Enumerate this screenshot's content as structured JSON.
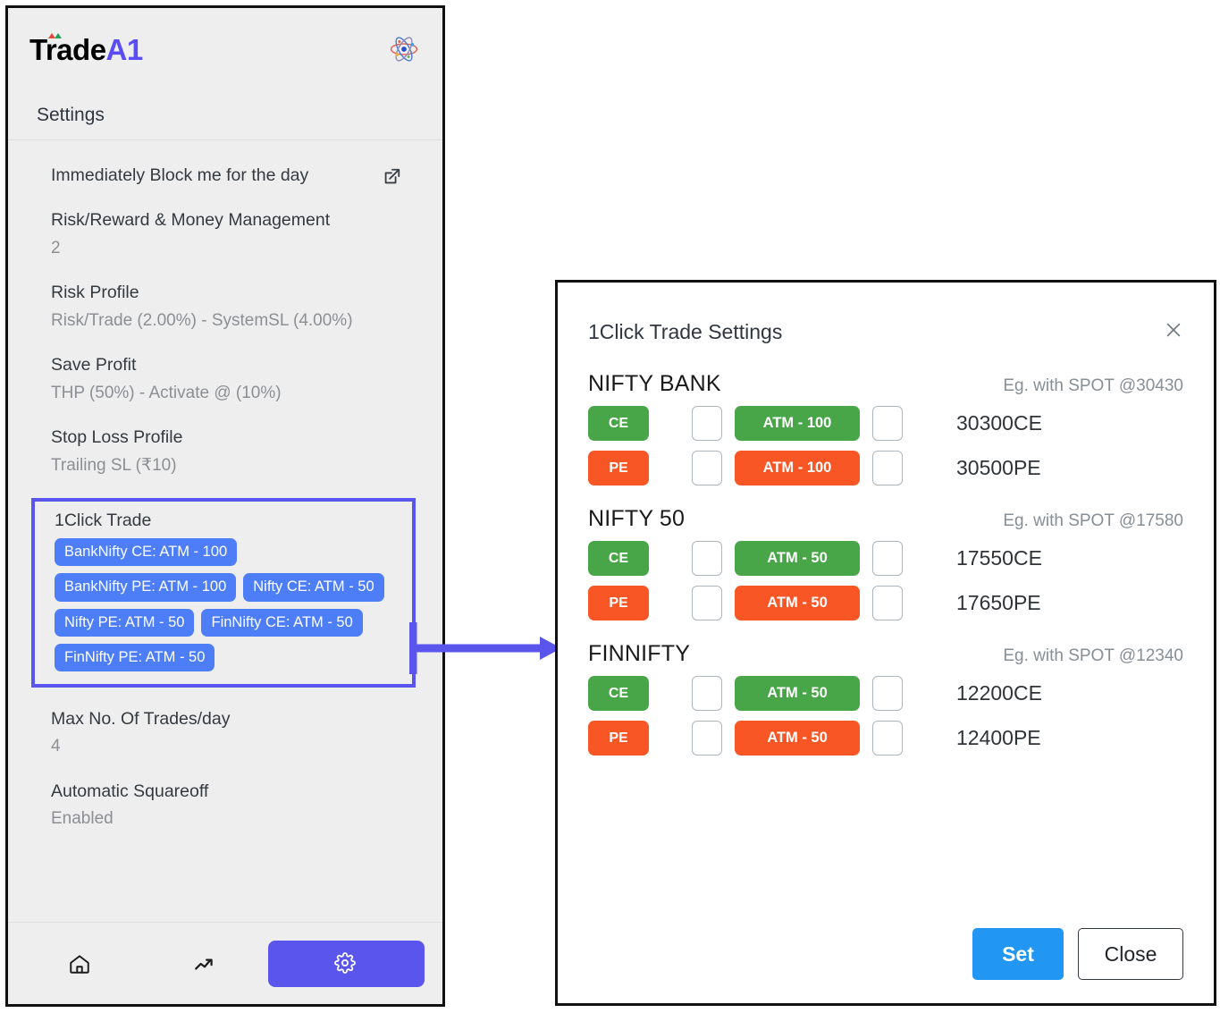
{
  "app": {
    "logo_primary": "Trade",
    "logo_accent": "A1",
    "accent_color": "#5a4df5",
    "atom_icon": "atom-icon"
  },
  "sidebar": {
    "header": "Settings",
    "items": [
      {
        "title": "Immediately Block me for the day",
        "sub": "",
        "icon": "external-link-icon"
      },
      {
        "title": "Risk/Reward & Money Management",
        "sub": "2",
        "icon": ""
      },
      {
        "title": "Risk Profile",
        "sub": "Risk/Trade (2.00%) - SystemSL (4.00%)",
        "icon": ""
      },
      {
        "title": "Save Profit",
        "sub": "THP (50%) - Activate @ (10%)",
        "icon": ""
      },
      {
        "title": "Stop Loss Profile",
        "sub": "Trailing SL (₹10)",
        "icon": ""
      }
    ],
    "oneclick": {
      "title": "1Click Trade",
      "highlight_color": "#5a55ec",
      "tag_color": "#4d7ef7",
      "tags": [
        "BankNifty CE: ATM - 100",
        "BankNifty PE: ATM - 100",
        "Nifty CE: ATM - 50",
        "Nifty PE: ATM - 50",
        "FinNifty CE: ATM - 50",
        "FinNifty PE: ATM - 50"
      ]
    },
    "items_after": [
      {
        "title": "Max No. Of Trades/day",
        "sub": "4"
      },
      {
        "title": "Automatic Squareoff",
        "sub": "Enabled"
      }
    ],
    "nav": [
      {
        "name": "home-icon",
        "active": false
      },
      {
        "name": "trending-up-icon",
        "active": false
      },
      {
        "name": "gear-icon",
        "active": true
      }
    ]
  },
  "dialog": {
    "title": "1Click Trade Settings",
    "close_icon": "close-icon",
    "ce_color": "#48a548",
    "pe_color": "#f95626",
    "groups": [
      {
        "name": "NIFTY BANK",
        "eg": "Eg. with SPOT @30430",
        "rows": [
          {
            "side": "CE",
            "atm": "ATM - 100",
            "strike": "30300CE"
          },
          {
            "side": "PE",
            "atm": "ATM - 100",
            "strike": "30500PE"
          }
        ]
      },
      {
        "name": "NIFTY 50",
        "eg": "Eg. with SPOT @17580",
        "rows": [
          {
            "side": "CE",
            "atm": "ATM - 50",
            "strike": "17550CE"
          },
          {
            "side": "PE",
            "atm": "ATM - 50",
            "strike": "17650PE"
          }
        ]
      },
      {
        "name": "FINNIFTY",
        "eg": "Eg. with SPOT @12340",
        "rows": [
          {
            "side": "CE",
            "atm": "ATM - 50",
            "strike": "12200CE"
          },
          {
            "side": "PE",
            "atm": "ATM - 50",
            "strike": "12400PE"
          }
        ]
      }
    ],
    "set_label": "Set",
    "close_label": "Close",
    "set_color": "#2196f3"
  }
}
